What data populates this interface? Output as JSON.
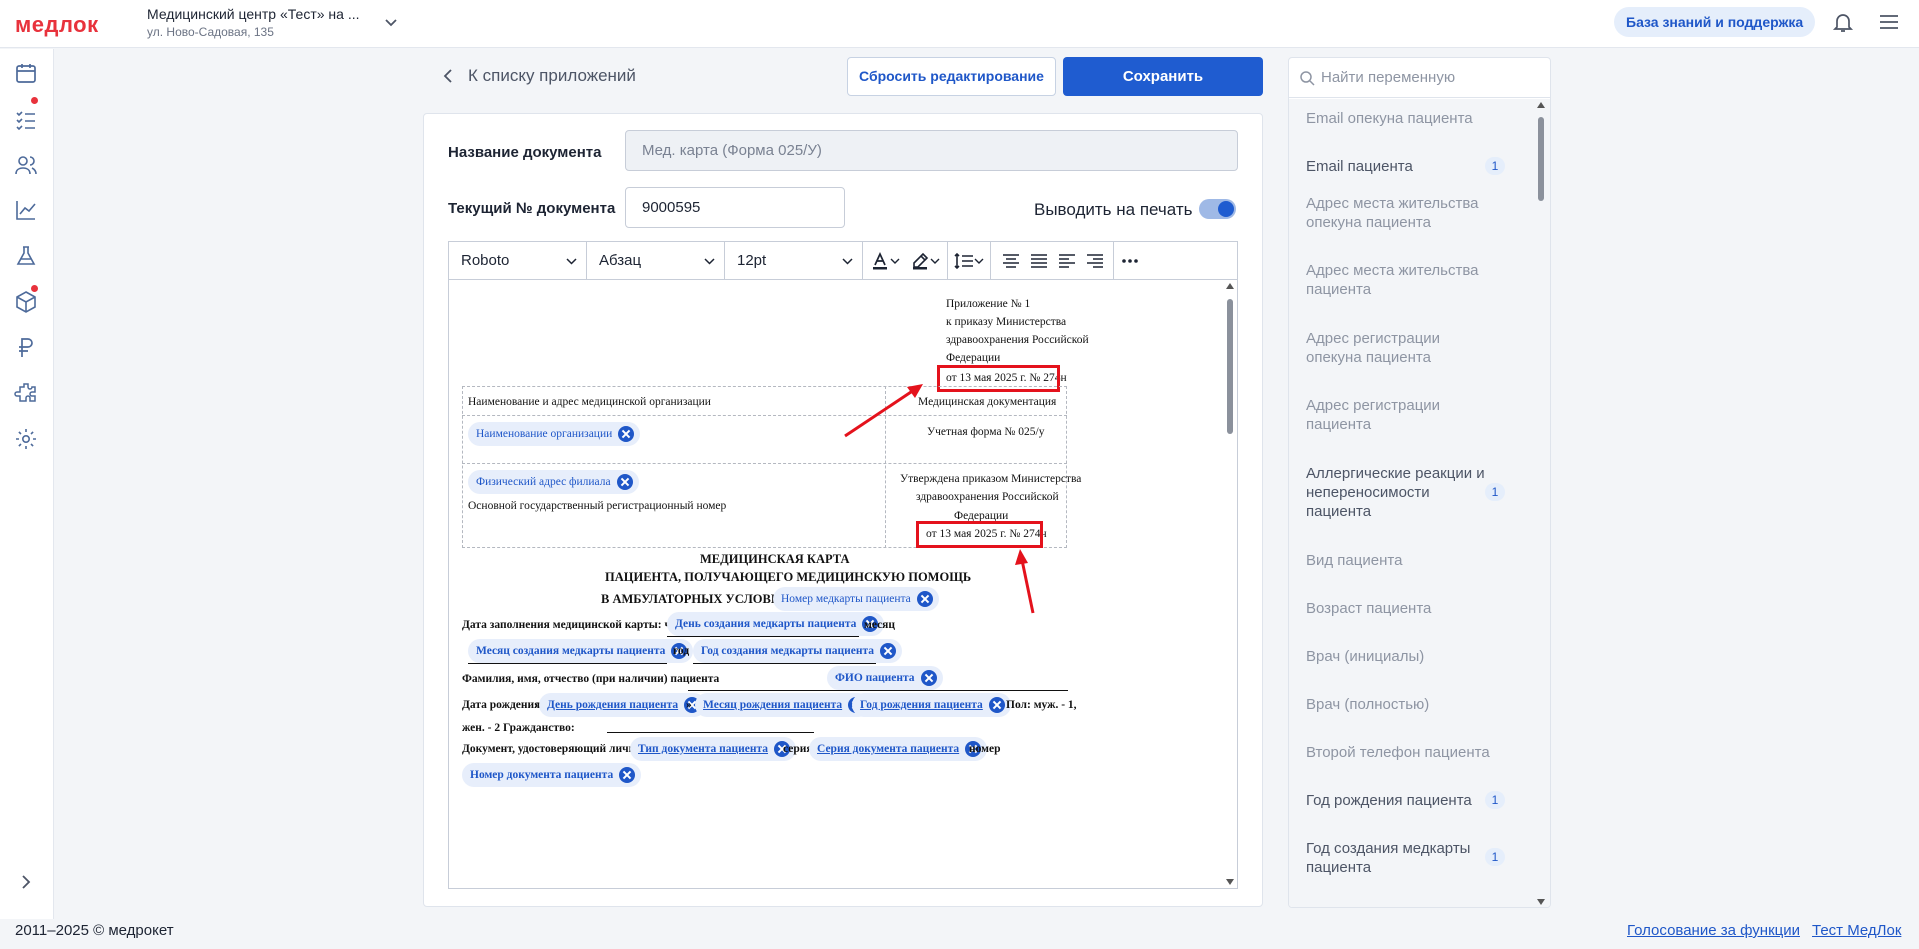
{
  "brand": {
    "logo": "медлок",
    "accent": "#e8323c",
    "primary": "#1f5cd0"
  },
  "header": {
    "clinic_name": "Медицинский центр «Тест» на ...",
    "clinic_address": "ул. Ново-Садовая, 135",
    "kb_button": "База знаний и поддержка"
  },
  "sidebar": {
    "items": [
      "calendar-icon",
      "tasks-icon",
      "patients-icon",
      "analytics-icon",
      "lab-icon",
      "warehouse-icon",
      "finance-icon",
      "integrations-icon",
      "settings-icon"
    ],
    "expand": "chevron-right-icon"
  },
  "nav": {
    "back_label": "К списку приложений",
    "reset_button": "Сбросить редактирование",
    "save_button": "Сохранить"
  },
  "form": {
    "doc_name_label": "Название документа",
    "doc_name_value": "Мед. карта (Форма 025/У)",
    "doc_number_label": "Текущий № документа",
    "doc_number_value": "9000595",
    "print_label": "Выводить на печать",
    "print_enabled": true
  },
  "toolbar": {
    "font": "Roboto",
    "block": "Абзац",
    "size": "12pt"
  },
  "document": {
    "appendix_lines": [
      "Приложение № 1",
      "к приказу Министерства",
      "здравоохранения Российской",
      "Федерации",
      "от 13 мая 2025 г. № 274н"
    ],
    "org_header": "Наименование и адрес медицинской организации",
    "med_docs": "Медицинская документация",
    "org_name_chip": "Наименование организации",
    "form_label": "Учетная форма № 025/у",
    "branch_address_chip": "Физический адрес филиала",
    "ogrn_label": "Основной государственный регистрационный номер",
    "approved_lines": [
      "Утверждена приказом Министерства",
      "здравоохранения Российской",
      "Федерации",
      "от 13 мая 2025 г. № 274н"
    ],
    "title_lines": [
      "МЕДИЦИНСКАЯ КАРТА",
      "ПАЦИЕНТА, ПОЛУЧАЮЩЕГО МЕДИЦИНСКУЮ ПОМОЩЬ",
      "В АМБУЛАТОРНЫХ УСЛОВИЯХ"
    ],
    "card_number_chip": "Номер медкарты пациента",
    "fill_date_label": "Дата заполнения медицинской карты: число",
    "day_created_chip": "День создания медкарты пациента",
    "month_word": "месяц",
    "month_created_chip": "Месяц создания медкарты пациента",
    "year_word": "год",
    "year_created_chip": "Год создания медкарты пациента",
    "fio_label": "Фамилия, имя, отчество (при наличии) пациента",
    "fio_chip": "ФИО пациента",
    "birth_label": "Дата рождения:",
    "birth_day_chip": "День рождения пациента",
    "birth_month_chip": "Месяц рождения пациента",
    "birth_year_chip": "Год рождения пациента",
    "sex_label": "Пол: муж. - 1,",
    "sex_label2": "жен. - 2 Гражданство:",
    "id_doc_label": "Документ, удостоверяющий личность",
    "id_doc_type_chip": "Тип документа пациента",
    "series_word": "серия",
    "series_chip": "Серия документа пациента",
    "number_word": "номер",
    "doc_number_chip": "Номер документа пациента"
  },
  "variables": {
    "search_placeholder": "Найти переменную",
    "items": [
      {
        "label": "Email опекуна пациента",
        "count": ""
      },
      {
        "label": "Email пациента",
        "count": "1"
      },
      {
        "label": "Адрес места жительства опекуна пациента",
        "count": ""
      },
      {
        "label": "Адрес места жительства пациента",
        "count": ""
      },
      {
        "label": "Адрес регистрации опекуна пациента",
        "count": ""
      },
      {
        "label": "Адрес регистрации пациента",
        "count": ""
      },
      {
        "label": "Аллергические реакции и непереносимости пациента",
        "count": "1"
      },
      {
        "label": "Вид пациента",
        "count": ""
      },
      {
        "label": "Возраст пациента",
        "count": ""
      },
      {
        "label": "Врач (инициалы)",
        "count": ""
      },
      {
        "label": "Врач (полностью)",
        "count": ""
      },
      {
        "label": "Второй телефон пациента",
        "count": ""
      },
      {
        "label": "Год рождения пациента",
        "count": "1"
      },
      {
        "label": "Год создания медкарты пациента",
        "count": "1"
      }
    ]
  },
  "footer": {
    "copyright": "2011–2025 © медрокет",
    "link1": "Голосование за функции",
    "link2": "Тест МедЛок"
  }
}
